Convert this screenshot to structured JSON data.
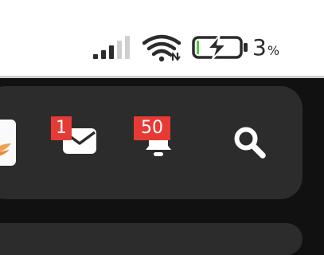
{
  "status_bar": {
    "signal_icon": "cellular-signal-icon",
    "wifi_icon": "wifi-icon",
    "battery_icon": "battery-charging-icon",
    "battery_level": 0.03,
    "battery_percent_value": "3",
    "battery_percent_sign": "%"
  },
  "app_bar": {
    "mail": {
      "icon": "envelope-icon",
      "badge": "1",
      "badge_color": "#e53b34"
    },
    "notifications": {
      "icon": "bell-icon",
      "badge": "50",
      "badge_color": "#e53b34"
    },
    "search": {
      "icon": "search-icon"
    }
  },
  "colors": {
    "status_bar_bg": "#ffffff",
    "page_bg": "#111111",
    "app_bar_bg": "#2c2c2c",
    "icon_color": "#ffffff",
    "status_icon_color": "#2c2c2c",
    "battery_charge_color": "#53c947"
  }
}
